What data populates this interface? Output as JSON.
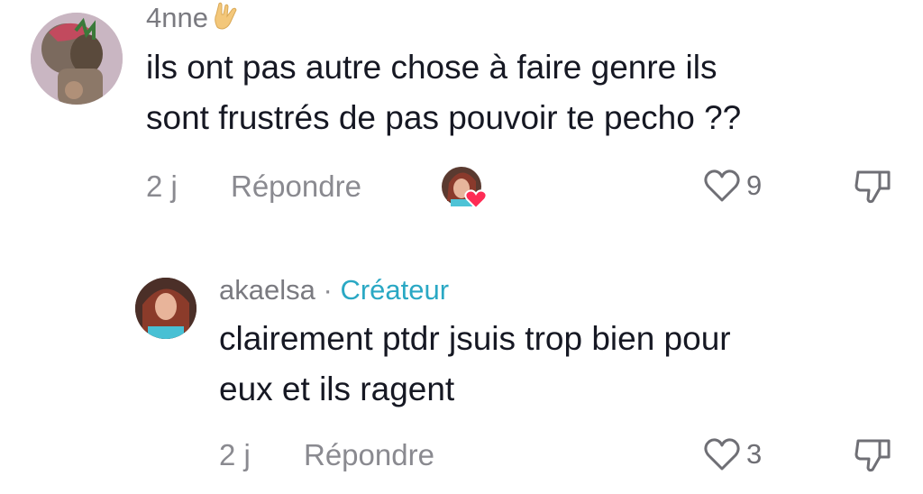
{
  "comments": [
    {
      "username": "4nne",
      "username_emoji": "rock-hand-emoji",
      "text_lines": [
        "ils ont pas autre chose à faire genre ils",
        "sont frustrés de pas pouvoir te pecho ??"
      ],
      "time": "2 j",
      "reply_label": "Répondre",
      "creator_liked": true,
      "likes": "9"
    },
    {
      "username": "akaelsa",
      "separator": "·",
      "badge": "Créateur",
      "text_lines": [
        "clairement ptdr jsuis trop bien pour",
        "eux et ils ragent"
      ],
      "time": "2 j",
      "reply_label": "Répondre",
      "likes": "3"
    }
  ],
  "colors": {
    "text": "#161823",
    "muted": "#8a8a90",
    "creator_badge": "#2aa8c4",
    "heart_badge": "#fe2c55"
  }
}
